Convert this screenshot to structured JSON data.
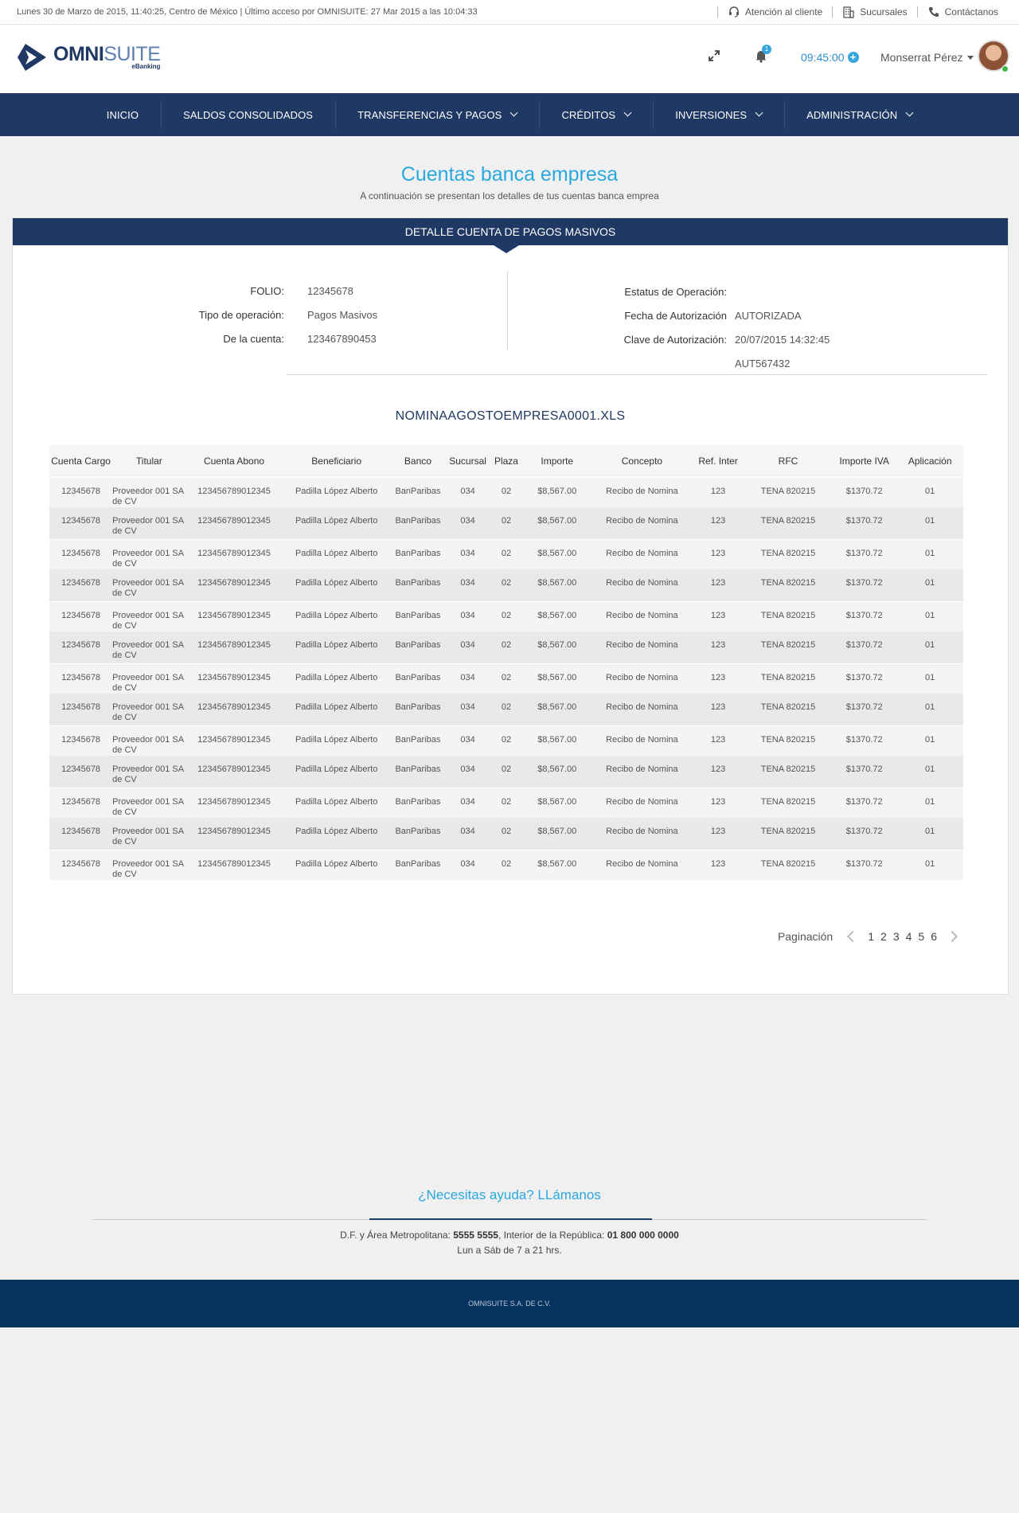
{
  "topbar": {
    "session_info": "Lunes 30 de Marzo de 2015, 11:40:25,  Centro de México | Último acceso por OMNISUITE: 27 Mar 2015 a las 10:04:33",
    "links": [
      {
        "label": "Atención al cliente",
        "icon": "headset-icon"
      },
      {
        "label": "Sucursales",
        "icon": "building-icon"
      },
      {
        "label": "Contáctanos",
        "icon": "phone-icon"
      }
    ]
  },
  "header": {
    "logo_bold": "OMNI",
    "logo_thin": "SUITE",
    "logo_sub": "eBanking",
    "notification_count": "1",
    "clock": "09:45:00",
    "user_name": "Monserrat Pérez"
  },
  "nav": {
    "items": [
      {
        "label": "INICIO",
        "dropdown": false
      },
      {
        "label": "SALDOS CONSOLIDADOS",
        "dropdown": false
      },
      {
        "label": "TRANSFERENCIAS Y PAGOS",
        "dropdown": true
      },
      {
        "label": "CRÉDITOS",
        "dropdown": true
      },
      {
        "label": "INVERSIONES",
        "dropdown": true
      },
      {
        "label": "ADMINISTRACIÓN",
        "dropdown": true
      }
    ]
  },
  "page": {
    "title": "Cuentas banca empresa",
    "subtitle": "A continuación se presentan los detalles de tus cuentas banca emprea"
  },
  "card": {
    "header": "DETALLE CUENTA DE PAGOS MASIVOS",
    "left": [
      {
        "label": "FOLIO:",
        "value": "12345678"
      },
      {
        "label": "Tipo de operación:",
        "value": "Pagos Masivos"
      },
      {
        "label": "De la cuenta:",
        "value": "123467890453"
      }
    ],
    "right_labels": [
      "Estatus de Operación:",
      "Fecha de Autorización",
      "Clave de Autorización:"
    ],
    "right_values": [
      "AUTORIZADA",
      "20/07/2015   14:32:45",
      "AUT567432"
    ],
    "file_name": "NOMINAAGOSTOEMPRESA0001.XLS"
  },
  "table": {
    "columns": [
      "Cuenta Cargo",
      "Titular",
      "Cuenta Abono",
      "Beneficiario",
      "Banco",
      "Sucursal",
      "Plaza",
      "Importe",
      "Concepto",
      "Ref. Inter",
      "RFC",
      "Importe IVA",
      "Aplicación"
    ],
    "rows": [
      [
        "12345678",
        "Proveedor 001 SA de CV",
        "123456789012345",
        "Padilla López Alberto",
        "BanParibas",
        "034",
        "02",
        "$8,567.00",
        "Recibo de Nomina",
        "123",
        "TENA 820215",
        "$1370.72",
        "01"
      ],
      [
        "12345678",
        "Proveedor 001 SA de CV",
        "123456789012345",
        "Padilla López Alberto",
        "BanParibas",
        "034",
        "02",
        "$8,567.00",
        "Recibo de Nomina",
        "123",
        "TENA 820215",
        "$1370.72",
        "01"
      ],
      [
        "12345678",
        "Proveedor 001 SA de CV",
        "123456789012345",
        "Padilla López Alberto",
        "BanParibas",
        "034",
        "02",
        "$8,567.00",
        "Recibo de Nomina",
        "123",
        "TENA 820215",
        "$1370.72",
        "01"
      ],
      [
        "12345678",
        "Proveedor 001 SA de CV",
        "123456789012345",
        "Padilla López Alberto",
        "BanParibas",
        "034",
        "02",
        "$8,567.00",
        "Recibo de Nomina",
        "123",
        "TENA 820215",
        "$1370.72",
        "01"
      ],
      [
        "12345678",
        "Proveedor 001 SA de CV",
        "123456789012345",
        "Padilla López Alberto",
        "BanParibas",
        "034",
        "02",
        "$8,567.00",
        "Recibo de Nomina",
        "123",
        "TENA 820215",
        "$1370.72",
        "01"
      ],
      [
        "12345678",
        "Proveedor 001 SA de CV",
        "123456789012345",
        "Padilla López Alberto",
        "BanParibas",
        "034",
        "02",
        "$8,567.00",
        "Recibo de Nomina",
        "123",
        "TENA 820215",
        "$1370.72",
        "01"
      ],
      [
        "12345678",
        "Proveedor 001 SA de CV",
        "123456789012345",
        "Padilla López Alberto",
        "BanParibas",
        "034",
        "02",
        "$8,567.00",
        "Recibo de Nomina",
        "123",
        "TENA 820215",
        "$1370.72",
        "01"
      ],
      [
        "12345678",
        "Proveedor 001 SA de CV",
        "123456789012345",
        "Padilla López Alberto",
        "BanParibas",
        "034",
        "02",
        "$8,567.00",
        "Recibo de Nomina",
        "123",
        "TENA 820215",
        "$1370.72",
        "01"
      ],
      [
        "12345678",
        "Proveedor 001 SA de CV",
        "123456789012345",
        "Padilla López Alberto",
        "BanParibas",
        "034",
        "02",
        "$8,567.00",
        "Recibo de Nomina",
        "123",
        "TENA 820215",
        "$1370.72",
        "01"
      ],
      [
        "12345678",
        "Proveedor 001 SA de CV",
        "123456789012345",
        "Padilla López Alberto",
        "BanParibas",
        "034",
        "02",
        "$8,567.00",
        "Recibo de Nomina",
        "123",
        "TENA 820215",
        "$1370.72",
        "01"
      ],
      [
        "12345678",
        "Proveedor 001 SA de CV",
        "123456789012345",
        "Padilla López Alberto",
        "BanParibas",
        "034",
        "02",
        "$8,567.00",
        "Recibo de Nomina",
        "123",
        "TENA 820215",
        "$1370.72",
        "01"
      ],
      [
        "12345678",
        "Proveedor 001 SA de CV",
        "123456789012345",
        "Padilla López Alberto",
        "BanParibas",
        "034",
        "02",
        "$8,567.00",
        "Recibo de Nomina",
        "123",
        "TENA 820215",
        "$1370.72",
        "01"
      ],
      [
        "12345678",
        "Proveedor 001 SA de CV",
        "123456789012345",
        "Padilla López Alberto",
        "BanParibas",
        "034",
        "02",
        "$8,567.00",
        "Recibo de Nomina",
        "123",
        "TENA 820215",
        "$1370.72",
        "01"
      ]
    ]
  },
  "pagination": {
    "label": "Paginación",
    "pages": [
      "1",
      "2",
      "3",
      "4",
      "5",
      "6"
    ]
  },
  "help": {
    "title": "¿Necesitas ayuda? LLámanos",
    "line1_a": "D.F. y Área Metropolitana: ",
    "line1_b": "5555 5555",
    "line1_c": ", Interior de la República: ",
    "line1_d": "01 800 000 0000",
    "line2": "Lun a Sáb de 7 a 21 hrs."
  },
  "footer": {
    "text": "OMNISUITE S.A. DE C.V."
  },
  "colors": {
    "navy": "#1f3864",
    "accent_blue": "#29a8e0",
    "footer_bg": "#073360"
  }
}
